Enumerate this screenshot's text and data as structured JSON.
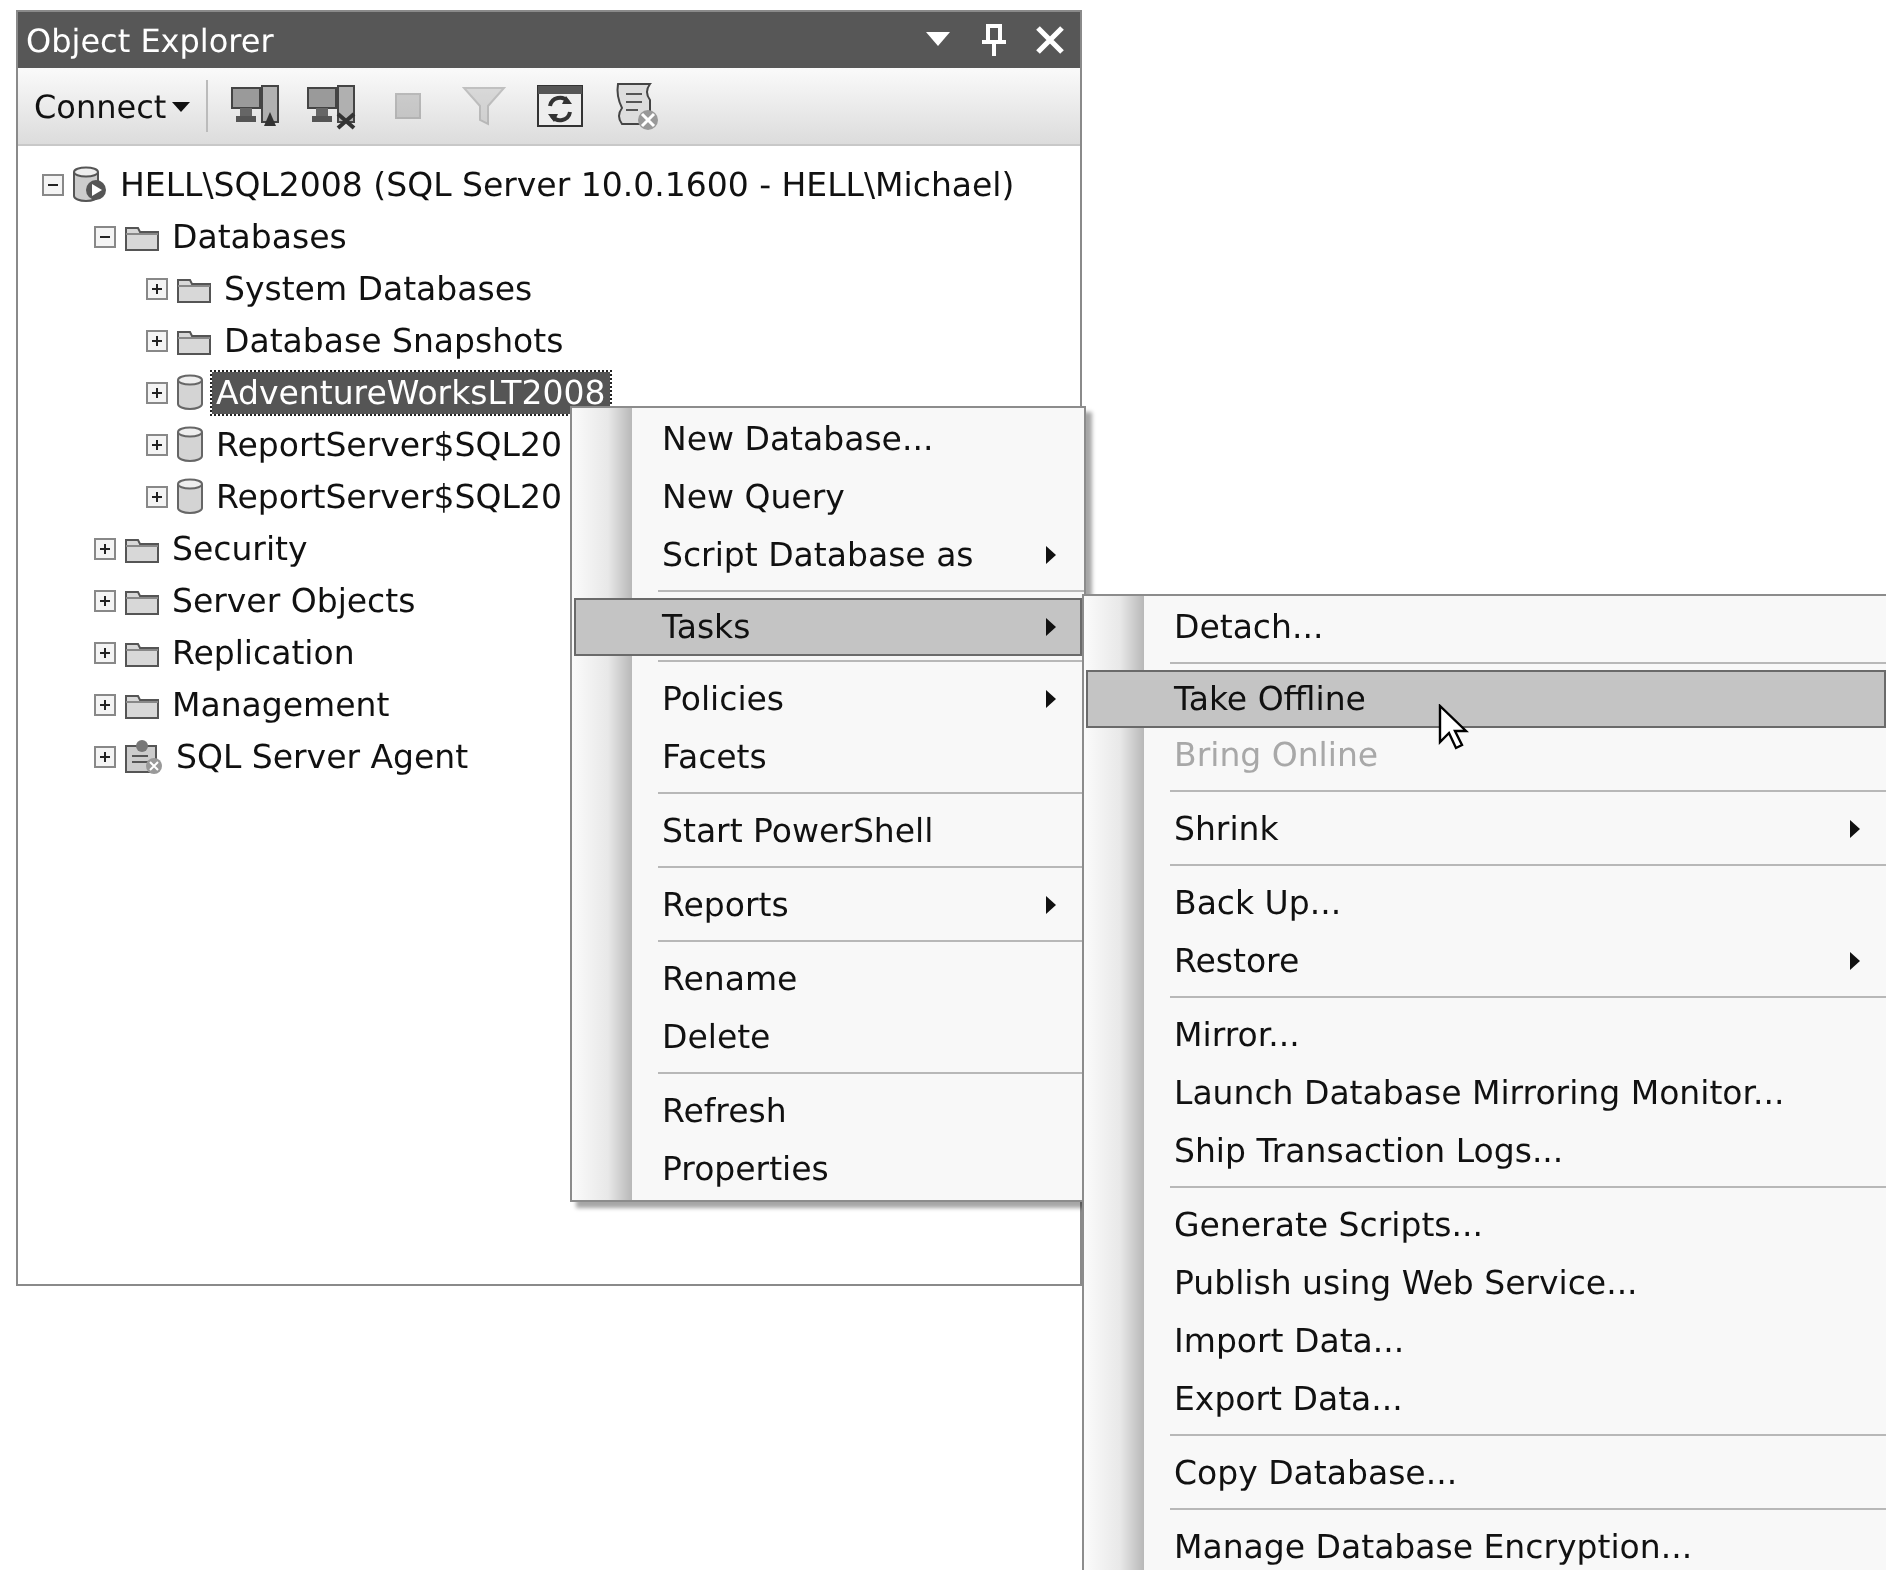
{
  "panel": {
    "title": "Object Explorer",
    "title_buttons": [
      {
        "kind": "dropdown"
      },
      {
        "kind": "pin"
      },
      {
        "kind": "close"
      }
    ]
  },
  "toolbar": {
    "connect": {
      "label": "Connect"
    },
    "buttons": [
      {
        "kind": "connect",
        "disabled": false
      },
      {
        "kind": "disconnect",
        "disabled": false
      },
      {
        "kind": "stop",
        "disabled": true
      },
      {
        "kind": "filter",
        "disabled": true
      },
      {
        "kind": "refresh",
        "disabled": false
      },
      {
        "kind": "script",
        "disabled": false
      }
    ]
  },
  "tree": [
    {
      "label": "HELL\\SQL2008 (SQL Server 10.0.1600 - HELL\\Michael)",
      "kind": "server",
      "expanded": true,
      "selected": false,
      "children": [
        {
          "label": "Databases",
          "kind": "folder",
          "expanded": true,
          "selected": false,
          "children": [
            {
              "label": "System Databases",
              "kind": "folder",
              "expanded": false,
              "selected": false
            },
            {
              "label": "Database Snapshots",
              "kind": "folder",
              "expanded": false,
              "selected": false
            },
            {
              "label": "AdventureWorksLT2008",
              "kind": "database",
              "expanded": false,
              "selected": true
            },
            {
              "label": "ReportServer$SQL20",
              "kind": "database",
              "expanded": false,
              "selected": false
            },
            {
              "label": "ReportServer$SQL20",
              "kind": "database",
              "expanded": false,
              "selected": false
            }
          ]
        },
        {
          "label": "Security",
          "kind": "folder",
          "expanded": false,
          "selected": false
        },
        {
          "label": "Server Objects",
          "kind": "folder",
          "expanded": false,
          "selected": false
        },
        {
          "label": "Replication",
          "kind": "folder",
          "expanded": false,
          "selected": false
        },
        {
          "label": "Management",
          "kind": "folder",
          "expanded": false,
          "selected": false
        },
        {
          "label": "SQL Server Agent",
          "kind": "agent",
          "expanded": false,
          "selected": false
        }
      ]
    }
  ],
  "context_menu": {
    "items": [
      {
        "kind": "item",
        "label": "New Database...",
        "submenu": false,
        "selected": false,
        "disabled": false
      },
      {
        "kind": "item",
        "label": "New Query",
        "submenu": false,
        "selected": false,
        "disabled": false
      },
      {
        "kind": "item",
        "label": "Script Database as",
        "submenu": true,
        "selected": false,
        "disabled": false
      },
      {
        "kind": "separator"
      },
      {
        "kind": "item",
        "label": "Tasks",
        "submenu": true,
        "selected": true,
        "disabled": false
      },
      {
        "kind": "separator"
      },
      {
        "kind": "item",
        "label": "Policies",
        "submenu": true,
        "selected": false,
        "disabled": false
      },
      {
        "kind": "item",
        "label": "Facets",
        "submenu": false,
        "selected": false,
        "disabled": false
      },
      {
        "kind": "separator"
      },
      {
        "kind": "item",
        "label": "Start PowerShell",
        "submenu": false,
        "selected": false,
        "disabled": false
      },
      {
        "kind": "separator"
      },
      {
        "kind": "item",
        "label": "Reports",
        "submenu": true,
        "selected": false,
        "disabled": false
      },
      {
        "kind": "separator"
      },
      {
        "kind": "item",
        "label": "Rename",
        "submenu": false,
        "selected": false,
        "disabled": false
      },
      {
        "kind": "item",
        "label": "Delete",
        "submenu": false,
        "selected": false,
        "disabled": false
      },
      {
        "kind": "separator"
      },
      {
        "kind": "item",
        "label": "Refresh",
        "submenu": false,
        "selected": false,
        "disabled": false
      },
      {
        "kind": "item",
        "label": "Properties",
        "submenu": false,
        "selected": false,
        "disabled": false
      }
    ]
  },
  "tasks_submenu": {
    "items": [
      {
        "kind": "item",
        "label": "Detach...",
        "submenu": false,
        "selected": false,
        "disabled": false
      },
      {
        "kind": "separator"
      },
      {
        "kind": "item",
        "label": "Take Offline",
        "submenu": false,
        "selected": true,
        "disabled": false
      },
      {
        "kind": "item",
        "label": "Bring Online",
        "submenu": false,
        "selected": false,
        "disabled": true
      },
      {
        "kind": "separator"
      },
      {
        "kind": "item",
        "label": "Shrink",
        "submenu": true,
        "selected": false,
        "disabled": false
      },
      {
        "kind": "separator"
      },
      {
        "kind": "item",
        "label": "Back Up...",
        "submenu": false,
        "selected": false,
        "disabled": false
      },
      {
        "kind": "item",
        "label": "Restore",
        "submenu": true,
        "selected": false,
        "disabled": false
      },
      {
        "kind": "separator"
      },
      {
        "kind": "item",
        "label": "Mirror...",
        "submenu": false,
        "selected": false,
        "disabled": false
      },
      {
        "kind": "item",
        "label": "Launch Database Mirroring Monitor...",
        "submenu": false,
        "selected": false,
        "disabled": false
      },
      {
        "kind": "item",
        "label": "Ship Transaction Logs...",
        "submenu": false,
        "selected": false,
        "disabled": false
      },
      {
        "kind": "separator"
      },
      {
        "kind": "item",
        "label": "Generate Scripts...",
        "submenu": false,
        "selected": false,
        "disabled": false
      },
      {
        "kind": "item",
        "label": "Publish using Web Service...",
        "submenu": false,
        "selected": false,
        "disabled": false
      },
      {
        "kind": "item",
        "label": "Import Data...",
        "submenu": false,
        "selected": false,
        "disabled": false
      },
      {
        "kind": "item",
        "label": "Export Data...",
        "submenu": false,
        "selected": false,
        "disabled": false
      },
      {
        "kind": "separator"
      },
      {
        "kind": "item",
        "label": "Copy Database...",
        "submenu": false,
        "selected": false,
        "disabled": false
      },
      {
        "kind": "separator"
      },
      {
        "kind": "item",
        "label": "Manage Database Encryption...",
        "submenu": false,
        "selected": false,
        "disabled": false
      }
    ]
  }
}
